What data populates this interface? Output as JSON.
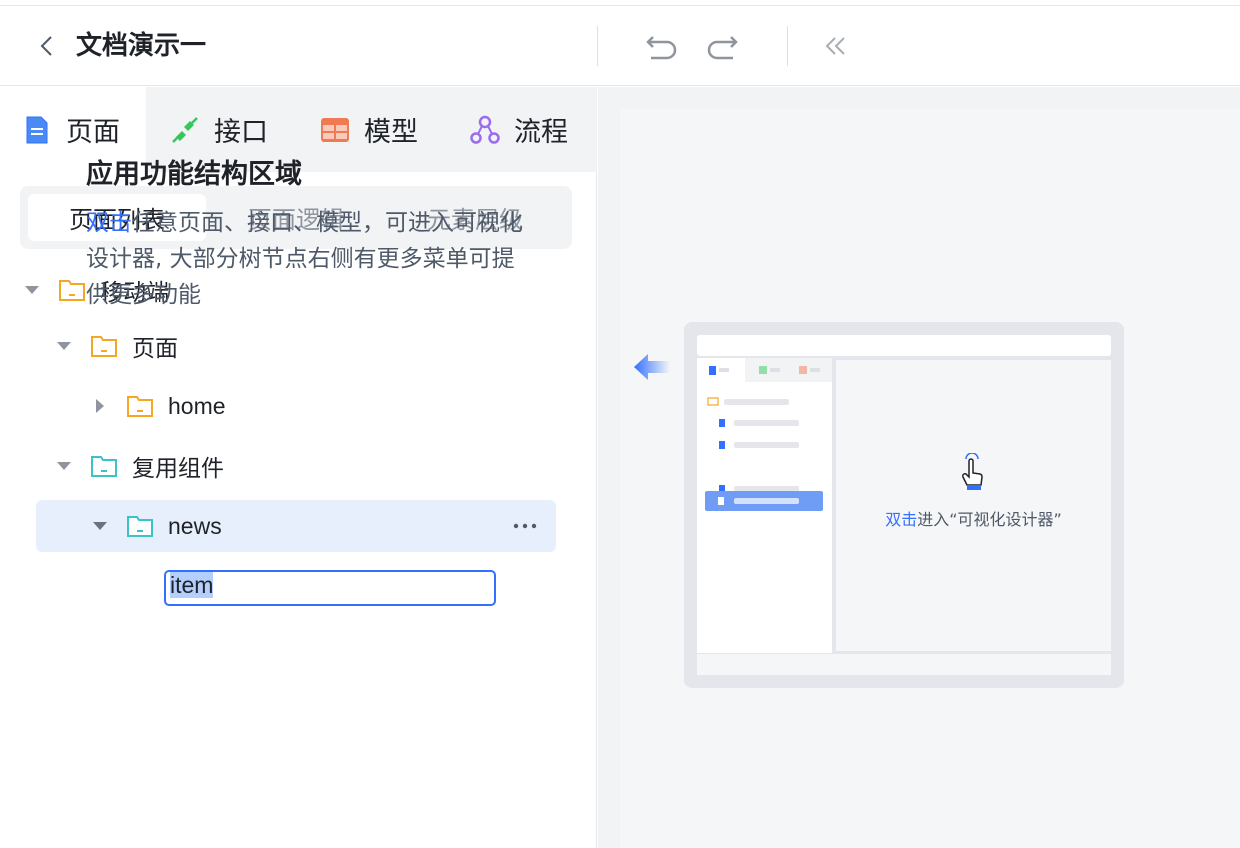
{
  "header": {
    "title": "文档演示一",
    "back_icon": "chevron-left-icon",
    "undo_icon": "undo-icon",
    "redo_icon": "redo-icon",
    "collapse_icon": "double-chevron-left-icon"
  },
  "tabs": [
    {
      "label": "页面",
      "icon": "page-icon",
      "color": "#3370ff",
      "active": true
    },
    {
      "label": "接口",
      "icon": "plug-icon",
      "color": "#34c759"
    },
    {
      "label": "模型",
      "icon": "table-icon",
      "color": "#f07a54"
    },
    {
      "label": "流程",
      "icon": "flow-icon",
      "color": "#9b6cf0"
    }
  ],
  "segments": [
    {
      "label": "页面列表",
      "active": true
    },
    {
      "label": "页面逻辑"
    },
    {
      "label": "元素层级"
    }
  ],
  "tree": {
    "mobile": "移动端",
    "pages": "页面",
    "home": "home",
    "components": "复用组件",
    "news": "news",
    "editing_value": "item",
    "folder_color_yellow": "#f5a623",
    "folder_color_teal": "#3cc2c9"
  },
  "guide": {
    "title": "应用功能结构区域",
    "desc_highlight": "双击",
    "desc_rest": "任意页面、接口、模型，可进入可视化设计器, 大部分树节点右侧有更多菜单可提供更多功能",
    "caption_highlight": "双击",
    "caption_rest": "进入“可视化设计器”"
  },
  "colors": {
    "accent": "#3370ff"
  }
}
